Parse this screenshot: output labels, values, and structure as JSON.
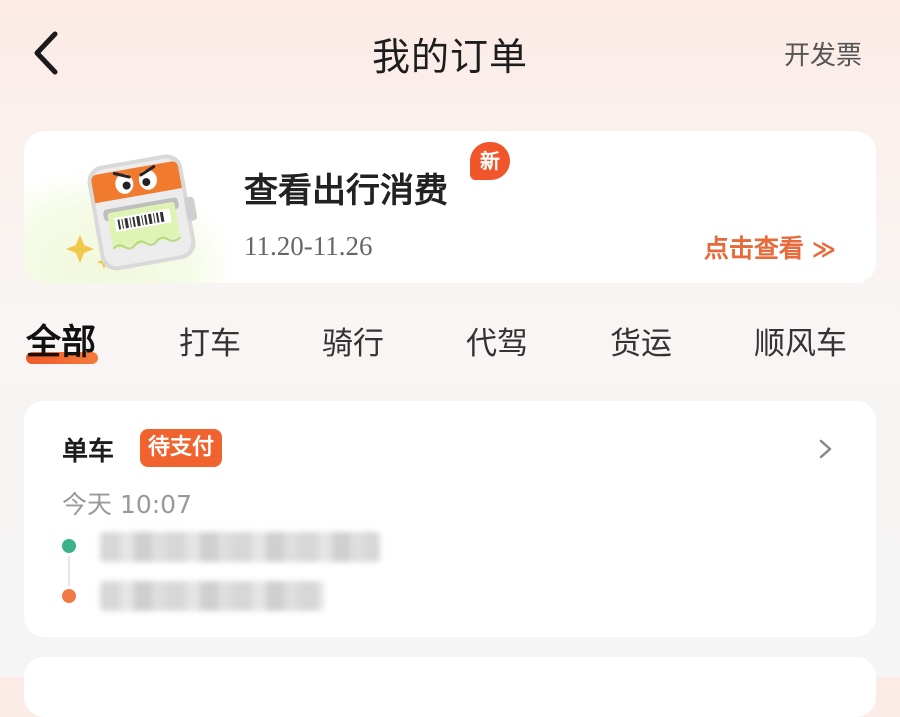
{
  "header": {
    "title": "我的订单",
    "invoice_label": "开发票"
  },
  "summary_card": {
    "title": "查看出行消费",
    "badge": "新",
    "date_range": "11.20-11.26",
    "link_label": "点击查看"
  },
  "tabs": [
    {
      "label": "全部",
      "active": true
    },
    {
      "label": "打车",
      "active": false
    },
    {
      "label": "骑行",
      "active": false
    },
    {
      "label": "代驾",
      "active": false
    },
    {
      "label": "货运",
      "active": false
    },
    {
      "label": "顺风车",
      "active": false
    }
  ],
  "orders": [
    {
      "type": "单车",
      "status": "待支付",
      "time": "今天 10:07"
    }
  ],
  "colors": {
    "accent": "#f0632f",
    "link": "#e8693a",
    "start_dot": "#3bb38a",
    "end_dot": "#f07a46"
  },
  "icons": {
    "back": "chevron-left-icon",
    "order_arrow": "chevron-right-icon",
    "link_arrow": "double-chevron-right-icon",
    "mascot": "ticket-mascot-icon"
  }
}
